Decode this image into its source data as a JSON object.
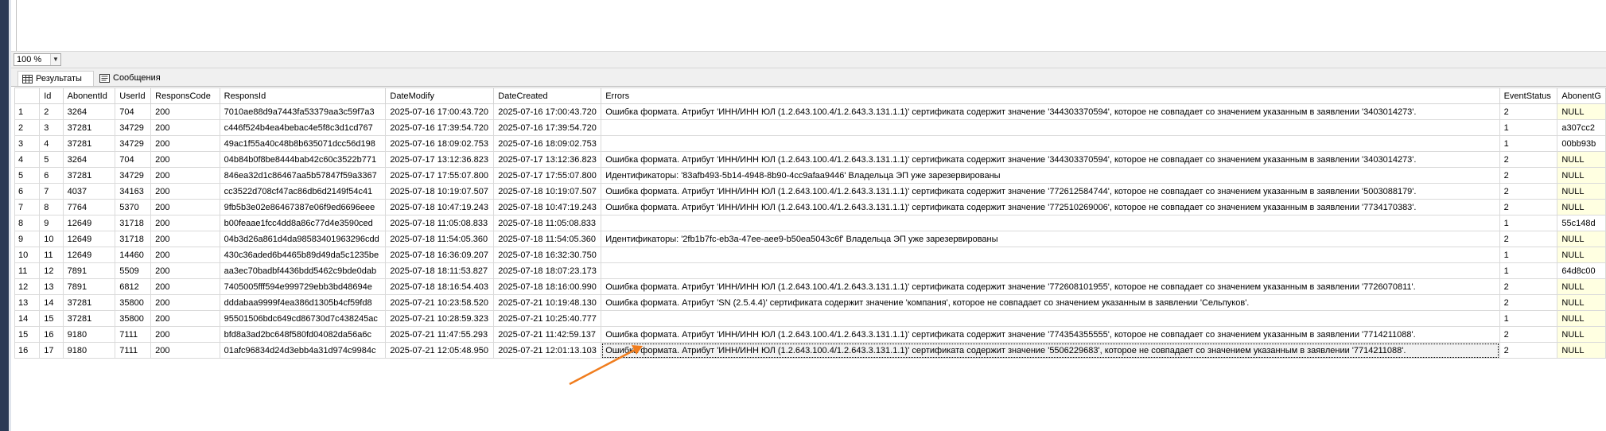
{
  "zoom": {
    "value": "100 %"
  },
  "tabs": [
    {
      "label": "Результаты",
      "icon": "grid-icon"
    },
    {
      "label": "Сообщения",
      "icon": "messages-icon"
    }
  ],
  "columns": [
    "Id",
    "AbonentId",
    "UserId",
    "ResponsCode",
    "ResponsId",
    "DateModify",
    "DateCreated",
    "Errors",
    "EventStatus",
    "AbonentG"
  ],
  "rows": [
    [
      "1",
      "2",
      "3264",
      "704",
      "200",
      "7010ae88d9a7443fa53379aa3c59f7a3",
      "2025-07-16 17:00:43.720",
      "2025-07-16 17:00:43.720",
      "Ошибка формата. Атрибут 'ИНН/ИНН ЮЛ (1.2.643.100.4/1.2.643.3.131.1.1)' сертификата содержит значение '344303370594', которое не совпадает со значением указанным в заявлении '3403014273'.",
      "2",
      "NULL"
    ],
    [
      "2",
      "3",
      "37281",
      "34729",
      "200",
      "c446f524b4ea4bebac4e5f8c3d1cd767",
      "2025-07-16 17:39:54.720",
      "2025-07-16 17:39:54.720",
      "",
      "1",
      "a307cc2"
    ],
    [
      "3",
      "4",
      "37281",
      "34729",
      "200",
      "49ac1f55a40c48b8b635071dcc56d198",
      "2025-07-16 18:09:02.753",
      "2025-07-16 18:09:02.753",
      "",
      "1",
      "00bb93b"
    ],
    [
      "4",
      "5",
      "3264",
      "704",
      "200",
      "04b84b0f8be8444bab42c60c3522b771",
      "2025-07-17 13:12:36.823",
      "2025-07-17 13:12:36.823",
      "Ошибка формата. Атрибут 'ИНН/ИНН ЮЛ (1.2.643.100.4/1.2.643.3.131.1.1)' сертификата содержит значение '344303370594', которое не совпадает со значением указанным в заявлении '3403014273'.",
      "2",
      "NULL"
    ],
    [
      "5",
      "6",
      "37281",
      "34729",
      "200",
      "846ea32d1c86467aa5b57847f59a3367",
      "2025-07-17 17:55:07.800",
      "2025-07-17 17:55:07.800",
      "Идентификаторы: '83afb493-5b14-4948-8b90-4cc9afaa9446' Владельца ЭП уже зарезервированы",
      "2",
      "NULL"
    ],
    [
      "6",
      "7",
      "4037",
      "34163",
      "200",
      "cc3522d708cf47ac86db6d2149f54c41",
      "2025-07-18 10:19:07.507",
      "2025-07-18 10:19:07.507",
      "Ошибка формата. Атрибут 'ИНН/ИНН ЮЛ (1.2.643.100.4/1.2.643.3.131.1.1)' сертификата содержит значение '772612584744', которое не совпадает со значением указанным в заявлении '5003088179'.",
      "2",
      "NULL"
    ],
    [
      "7",
      "8",
      "7764",
      "5370",
      "200",
      "9fb5b3e02e86467387e06f9ed6696eee",
      "2025-07-18 10:47:19.243",
      "2025-07-18 10:47:19.243",
      "Ошибка формата. Атрибут 'ИНН/ИНН ЮЛ (1.2.643.100.4/1.2.643.3.131.1.1)' сертификата содержит значение '772510269006', которое не совпадает со значением указанным в заявлении '7734170383'.",
      "2",
      "NULL"
    ],
    [
      "8",
      "9",
      "12649",
      "31718",
      "200",
      "b00feaae1fcc4dd8a86c77d4e3590ced",
      "2025-07-18 11:05:08.833",
      "2025-07-18 11:05:08.833",
      "",
      "1",
      "55c148d"
    ],
    [
      "9",
      "10",
      "12649",
      "31718",
      "200",
      "04b3d26a861d4da98583401963296cdd",
      "2025-07-18 11:54:05.360",
      "2025-07-18 11:54:05.360",
      "Идентификаторы: '2fb1b7fc-eb3a-47ee-aee9-b50ea5043c6f' Владельца ЭП уже зарезервированы",
      "2",
      "NULL"
    ],
    [
      "10",
      "11",
      "12649",
      "14460",
      "200",
      "430c36aded6b4465b89d49da5c1235be",
      "2025-07-18 16:36:09.207",
      "2025-07-18 16:32:30.750",
      "",
      "1",
      "NULL"
    ],
    [
      "11",
      "12",
      "7891",
      "5509",
      "200",
      "aa3ec70badbf4436bdd5462c9bde0dab",
      "2025-07-18 18:11:53.827",
      "2025-07-18 18:07:23.173",
      "",
      "1",
      "64d8c00"
    ],
    [
      "12",
      "13",
      "7891",
      "6812",
      "200",
      "7405005fff594e999729ebb3bd48694e",
      "2025-07-18 18:16:54.403",
      "2025-07-18 18:16:00.990",
      "Ошибка формата. Атрибут 'ИНН/ИНН ЮЛ (1.2.643.100.4/1.2.643.3.131.1.1)' сертификата содержит значение '772608101955', которое не совпадает со значением указанным в заявлении '7726070811'.",
      "2",
      "NULL"
    ],
    [
      "13",
      "14",
      "37281",
      "35800",
      "200",
      "dddabaa9999f4ea386d1305b4cf59fd8",
      "2025-07-21 10:23:58.520",
      "2025-07-21 10:19:48.130",
      "Ошибка формата. Атрибут 'SN (2.5.4.4)' сертификата содержит значение 'компания', которое не совпадает со значением указанным в заявлении 'Сельпуков'.",
      "2",
      "NULL"
    ],
    [
      "14",
      "15",
      "37281",
      "35800",
      "200",
      "95501506bdc649cd86730d7c438245ac",
      "2025-07-21 10:28:59.323",
      "2025-07-21 10:25:40.777",
      "",
      "1",
      "NULL"
    ],
    [
      "15",
      "16",
      "9180",
      "7111",
      "200",
      "bfd8a3ad2bc648f580fd04082da56a6c",
      "2025-07-21 11:47:55.293",
      "2025-07-21 11:42:59.137",
      "Ошибка формата. Атрибут 'ИНН/ИНН ЮЛ (1.2.643.100.4/1.2.643.3.131.1.1)' сертификата содержит значение '774354355555', которое не совпадает со значением указанным в заявлении '7714211088'.",
      "2",
      "NULL"
    ],
    [
      "16",
      "17",
      "9180",
      "7111",
      "200",
      "01afc96834d24d3ebb4a31d974c9984c",
      "2025-07-21 12:05:48.950",
      "2025-07-21 12:01:13.103",
      "Ошибка формата. Атрибут 'ИНН/ИНН ЮЛ (1.2.643.100.4/1.2.643.3.131.1.1)' сертификата содержит значение '5506229683', которое не совпадает со значением указанным в заявлении '7714211088'.",
      "2",
      "NULL"
    ]
  ],
  "selected_cell": {
    "row": 16,
    "column": "Errors"
  },
  "colors": {
    "null_cell": "#ffffe1",
    "arrow": "#f07d1e",
    "window_border": "#2b3a55"
  }
}
